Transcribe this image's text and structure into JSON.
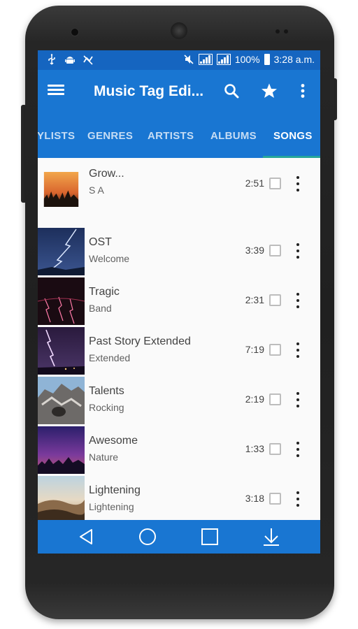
{
  "status_bar": {
    "left_icons": [
      "usb-icon",
      "android-icon",
      "sync-off-icon"
    ],
    "right_icons": [
      "mute-icon",
      "signal-icon",
      "signal-icon"
    ],
    "battery": "100%",
    "time": "3:28 a.m."
  },
  "app_bar": {
    "title": "Music Tag Edi...",
    "menu_icon": "hamburger-menu-icon",
    "actions": [
      "search-icon",
      "star-icon",
      "more-vertical-icon"
    ]
  },
  "tabs": [
    {
      "label": "YLISTS"
    },
    {
      "label": "GENRES"
    },
    {
      "label": "ARTISTS"
    },
    {
      "label": "ALBUMS"
    },
    {
      "label": "SONGS"
    }
  ],
  "active_tab": "SONGS",
  "songs": [
    {
      "title": "Grow...",
      "subtitle": "S A",
      "duration": "2:51",
      "thumb": "sunset"
    },
    {
      "title": "OST",
      "subtitle": "Welcome",
      "duration": "3:39",
      "thumb": "lightning-blue"
    },
    {
      "title": "Tragic",
      "subtitle": "Band",
      "duration": "2:31",
      "thumb": "lightning-red"
    },
    {
      "title": "Past Story Extended",
      "subtitle": "Extended",
      "duration": "7:19",
      "thumb": "lightning-purple"
    },
    {
      "title": "Talents",
      "subtitle": "Rocking",
      "duration": "2:19",
      "thumb": "rocks"
    },
    {
      "title": "Awesome",
      "subtitle": "Nature",
      "duration": "1:33",
      "thumb": "purple-sky"
    },
    {
      "title": "Lightening",
      "subtitle": "Lightening",
      "duration": "3:18",
      "thumb": "desert"
    }
  ],
  "nav_bar": [
    "back-icon",
    "home-icon",
    "recents-icon",
    "download-icon"
  ],
  "colors": {
    "primary": "#1976d2",
    "status_bar": "#1565c0",
    "tab_indicator": "#26a69a"
  }
}
